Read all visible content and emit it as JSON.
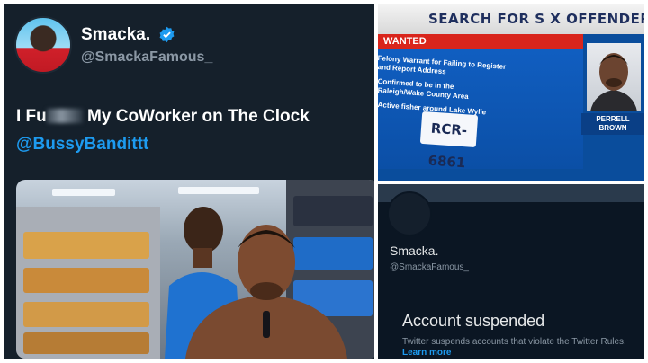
{
  "tweet": {
    "display_name": "Smacka.",
    "handle": "@SmackaFamous_",
    "text_before": "I Fu",
    "text_after": " My CoWorker on The Clock",
    "mention": "@BussyBandittt",
    "icons": {
      "verified": "verified-badge-icon",
      "avatar": "avatar"
    }
  },
  "news": {
    "banner": "SEARCH FOR S X OFFENDER",
    "label": "WANTED",
    "lines": [
      "Felony Warrant for Failing to Register",
      "and Report Address",
      "Confirmed to be in the",
      "Raleigh/Wake County Area",
      "Active fisher around Lake Wylie"
    ],
    "plate": "RCR-6861",
    "name_first": "PERRELL",
    "name_last": "BROWN"
  },
  "suspended": {
    "name": "Smacka.",
    "handle": "@SmackaFamous_",
    "title": "Account suspended",
    "body": "Twitter suspends accounts that violate the Twitter Rules.",
    "learn_more": "Learn more"
  },
  "colors": {
    "twitter_dark": "#15202b",
    "twitter_blue": "#1d9bf0",
    "news_blue": "#0a4d9c",
    "wanted_red": "#d9251c"
  }
}
